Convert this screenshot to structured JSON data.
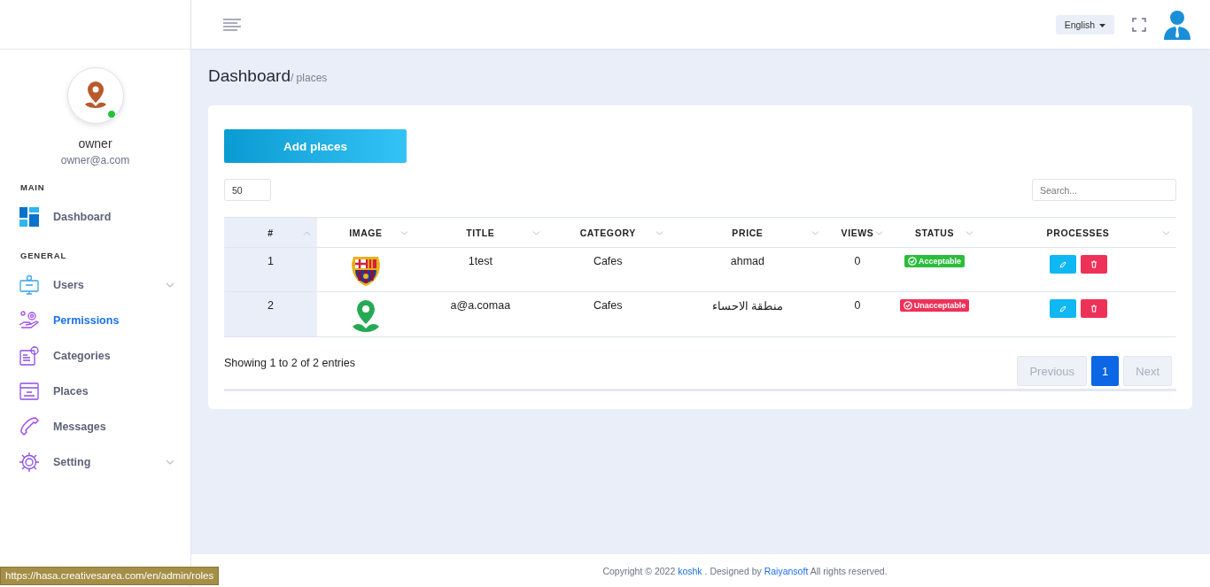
{
  "topbar": {
    "language": "English"
  },
  "profile": {
    "name": "owner",
    "email": "owner@a.com",
    "online": true
  },
  "sidebar": {
    "sections": [
      {
        "heading": "MAIN",
        "items": [
          {
            "label": "Dashboard",
            "selected": false,
            "expandable": false
          }
        ]
      },
      {
        "heading": "GENERAL",
        "items": [
          {
            "label": "Users",
            "selected": false,
            "expandable": true
          },
          {
            "label": "Permissions",
            "selected": true,
            "expandable": false
          },
          {
            "label": "Categories",
            "selected": false,
            "expandable": false
          },
          {
            "label": "Places",
            "selected": false,
            "expandable": false
          },
          {
            "label": "Messages",
            "selected": false,
            "expandable": false
          },
          {
            "label": "Setting",
            "selected": false,
            "expandable": true
          }
        ]
      }
    ]
  },
  "page": {
    "title": "Dashboard",
    "breadcrumb": "/ places"
  },
  "add_button": "Add places",
  "page_size": "50",
  "search": {
    "placeholder": "Search..."
  },
  "table": {
    "columns": [
      {
        "label": "#",
        "sorted": true
      },
      {
        "label": "IMAGE",
        "sorted": false
      },
      {
        "label": "TITLE",
        "sorted": false
      },
      {
        "label": "CATEGORY",
        "sorted": false
      },
      {
        "label": "PRICE",
        "sorted": false
      },
      {
        "label": "VIEWS",
        "sorted": false
      },
      {
        "label": "STATUS",
        "sorted": false
      },
      {
        "label": "PROCESSES",
        "sorted": false
      }
    ],
    "rows": [
      {
        "number": "1",
        "title": "1test",
        "category": "Cafes",
        "price": "ahmad",
        "views": "0",
        "status": {
          "label": "Acceptable",
          "kind": "acceptable"
        }
      },
      {
        "number": "2",
        "title": "a@a.comaa",
        "category": "Cafes",
        "price": "منطقة الاحساء",
        "views": "0",
        "status": {
          "label": "Unacceptable",
          "kind": "unacceptable"
        }
      }
    ]
  },
  "summary": "Showing 1 to 2 of 2 entries",
  "pagination": {
    "previous": {
      "label": "Previous",
      "disabled": true
    },
    "pages": [
      {
        "label": "1",
        "selected": true
      }
    ],
    "next": {
      "label": "Next",
      "disabled": true
    }
  },
  "footer": {
    "parts": [
      {
        "text": "Copyright © 2022",
        "link": false
      },
      {
        "text": "koshk",
        "link": true
      },
      {
        "text": ". Designed by",
        "link": false
      },
      {
        "text": "Raiyansoft",
        "link": true
      },
      {
        "text": "All rights reserved.",
        "link": false
      }
    ]
  },
  "status_bar": {
    "url": "https://hasa.creativesarea.com/en/admin/roles"
  }
}
